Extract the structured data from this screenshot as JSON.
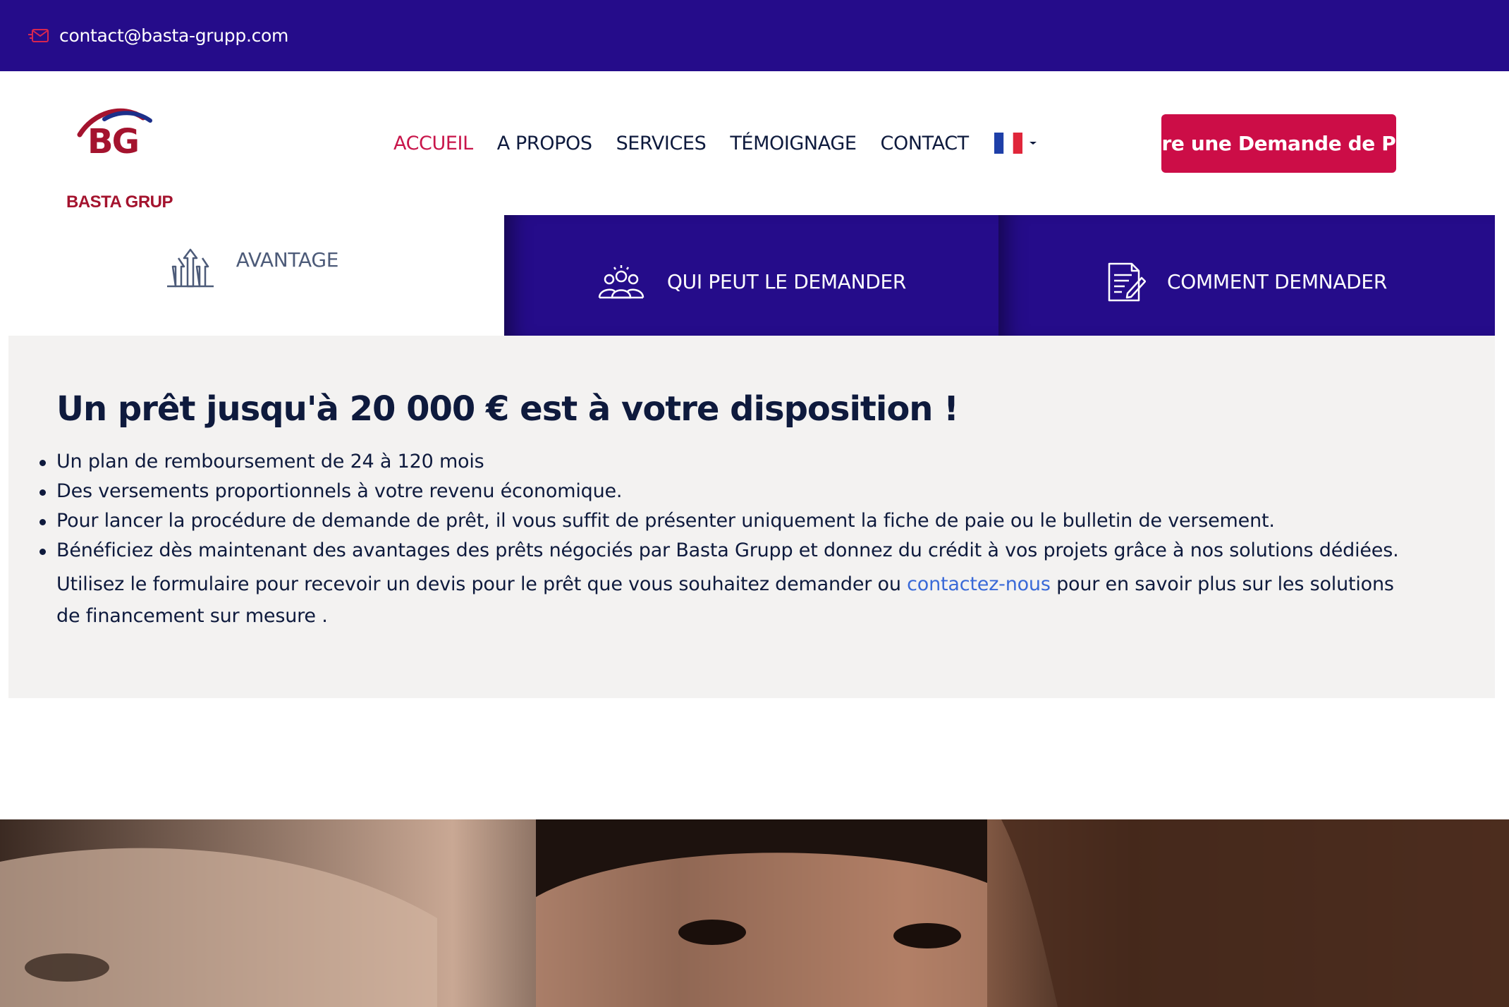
{
  "topbar": {
    "email": "contact@basta-grupp.com",
    "icon": "mail-icon"
  },
  "logo": {
    "mark": "BG",
    "name": "BASTA GRUP"
  },
  "nav": {
    "items": [
      {
        "label": "ACCUEIL",
        "active": true
      },
      {
        "label": "A PROPOS",
        "active": false
      },
      {
        "label": "SERVICES",
        "active": false
      },
      {
        "label": "TÉMOIGNAGE",
        "active": false
      },
      {
        "label": "CONTACT",
        "active": false
      }
    ],
    "language_icon": "flag-france-icon"
  },
  "cta": {
    "label": "Faire une Demande de Prêt"
  },
  "tabs": [
    {
      "label": "AVANTAGE",
      "icon": "arrows-up-icon",
      "active": true
    },
    {
      "label": "QUI PEUT LE DEMANDER",
      "icon": "group-people-icon",
      "active": false
    },
    {
      "label": "COMMENT DEMNADER",
      "icon": "document-edit-icon",
      "active": false
    }
  ],
  "panel": {
    "title": "Un prêt jusqu'à 20 000 € est à votre disposition !",
    "bullets": [
      "Un plan de remboursement de 24 à 120 mois",
      "Des versements proportionnels à votre revenu économique.",
      "Pour lancer la procédure de demande de prêt, il vous suffit de présenter uniquement la fiche de paie ou le bulletin de versement.",
      "Bénéficiez dès maintenant des avantages des prêts négociés par Basta Grupp et donnez du crédit à vos projets grâce à nos solutions dédiées."
    ],
    "paragraph_before": "Utilisez le formulaire pour recevoir un devis pour le prêt que vous souhaitez demander ou ",
    "link": "contactez-nous",
    "paragraph_after": " pour en savoir plus sur les solutions de financement sur mesure ."
  },
  "colors": {
    "primary": "#250c8a",
    "accent": "#cc0d47",
    "text": "#0e1a3d",
    "panel_bg": "#f3f2f1",
    "link": "#3a6ad8"
  }
}
